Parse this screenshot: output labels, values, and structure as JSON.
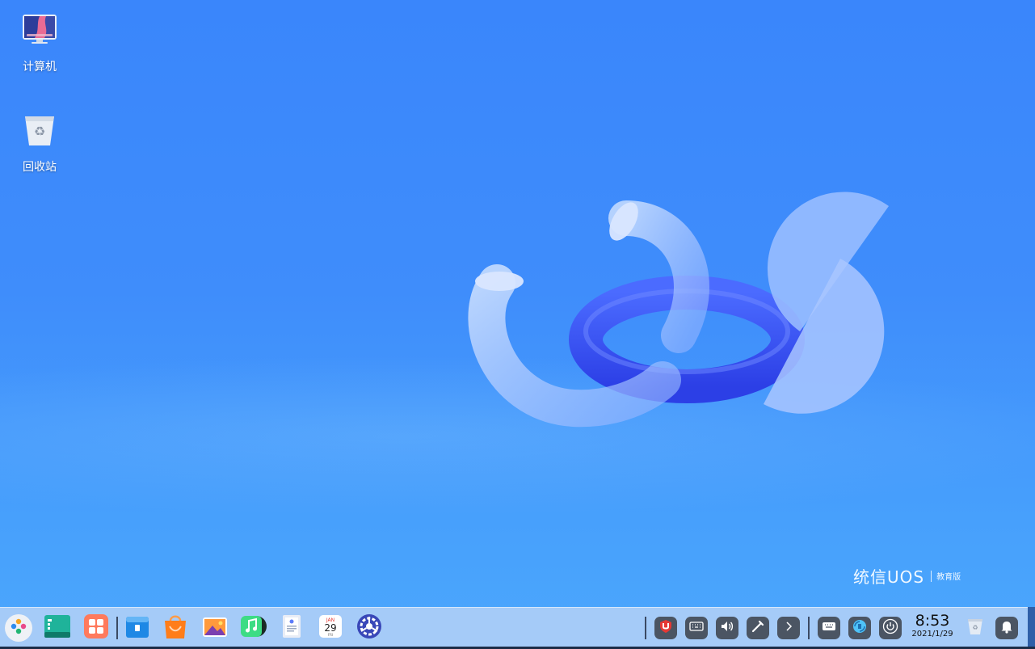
{
  "desktop": {
    "icons": [
      {
        "label": "计算机",
        "icon": "computer-icon"
      },
      {
        "label": "回收站",
        "icon": "trash-icon"
      }
    ],
    "brand": {
      "name": "统信UOS",
      "edition": "教育版"
    }
  },
  "dock": {
    "apps": [
      {
        "icon": "launcher-icon"
      },
      {
        "icon": "terminal-icon"
      },
      {
        "icon": "multitask-view-icon"
      },
      {
        "icon": "file-manager-icon"
      },
      {
        "icon": "app-store-icon"
      },
      {
        "icon": "image-viewer-icon"
      },
      {
        "icon": "music-icon"
      },
      {
        "icon": "document-viewer-icon"
      },
      {
        "icon": "calendar-icon",
        "month": "JAN",
        "day": "29",
        "weekday": "FRI"
      },
      {
        "icon": "control-center-icon"
      }
    ],
    "tray": [
      {
        "icon": "security-center-icon"
      },
      {
        "icon": "onboard-keyboard-icon"
      },
      {
        "icon": "volume-icon"
      },
      {
        "icon": "screenshot-icon"
      },
      {
        "icon": "expand-tray-icon"
      },
      {
        "icon": "keyboard-layout-icon"
      },
      {
        "icon": "network-icon"
      },
      {
        "icon": "power-icon"
      }
    ],
    "clock": {
      "time": "8:53",
      "date": "2021/1/29"
    },
    "trash": {
      "icon": "dock-trash-icon"
    },
    "notification": {
      "icon": "notification-bell-icon"
    }
  },
  "colors": {
    "wallpaper": "#3f8dfb",
    "dock_bg": "#b2d0f7",
    "tray_bg": "#4b5563"
  }
}
